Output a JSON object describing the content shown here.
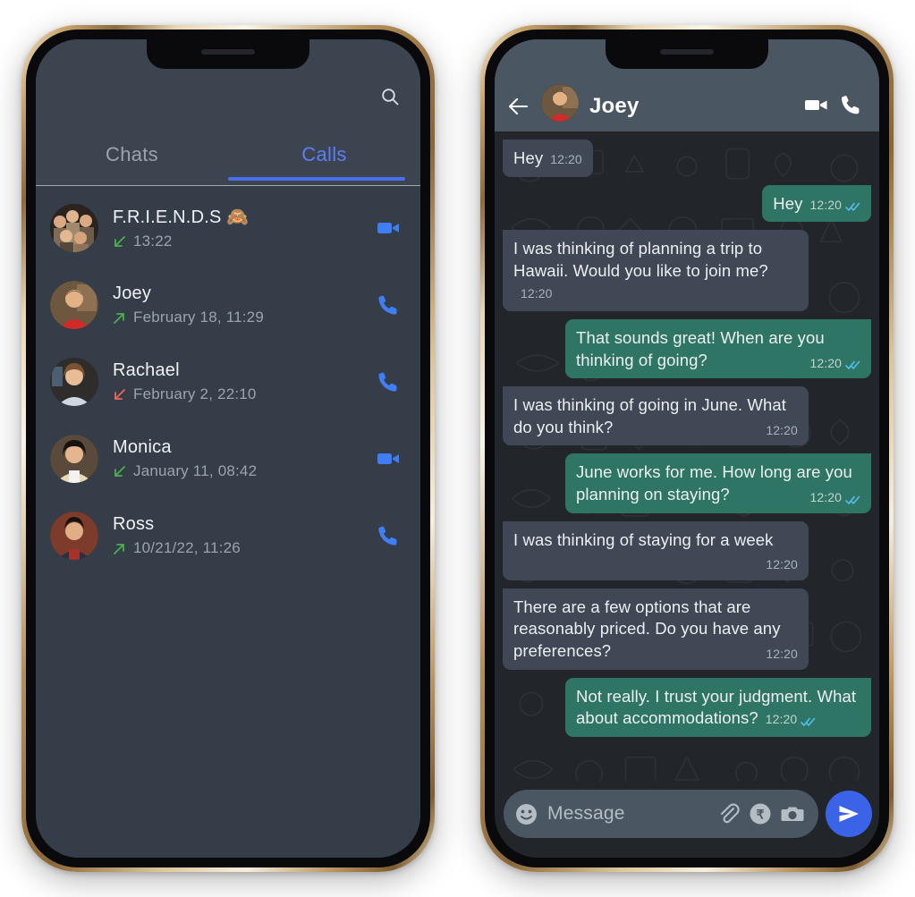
{
  "left_phone": {
    "topbar": {
      "search_icon": "search-icon"
    },
    "tabs": [
      {
        "label": "Chats",
        "active": false
      },
      {
        "label": "Calls",
        "active": true
      }
    ],
    "accent_color": "#4a6ef0",
    "calls": [
      {
        "name": "F.R.I.E.N.D.S 🙈",
        "time": "13:22",
        "direction": "incoming",
        "direction_color": "#4caf50",
        "action_icon": "video-call-icon",
        "action_color": "#3f7ef5"
      },
      {
        "name": "Joey",
        "time": "February 18, 11:29",
        "direction": "outgoing",
        "direction_color": "#4caf50",
        "action_icon": "voice-call-icon",
        "action_color": "#3f7ef5"
      },
      {
        "name": "Rachael",
        "time": "February 2, 22:10",
        "direction": "missed",
        "direction_color": "#e8685d",
        "action_icon": "voice-call-icon",
        "action_color": "#3f7ef5"
      },
      {
        "name": "Monica",
        "time": "January 11, 08:42",
        "direction": "incoming",
        "direction_color": "#4caf50",
        "action_icon": "video-call-icon",
        "action_color": "#3f7ef5"
      },
      {
        "name": "Ross",
        "time": "10/21/22, 11:26",
        "direction": "outgoing",
        "direction_color": "#4caf50",
        "action_icon": "voice-call-icon",
        "action_color": "#3f7ef5"
      }
    ]
  },
  "right_phone": {
    "header": {
      "back_icon": "back-arrow-icon",
      "title": "Joey",
      "video_icon": "video-call-icon",
      "call_icon": "voice-call-icon",
      "bar_color": "#4b5663"
    },
    "messages": [
      {
        "text": "Hey",
        "time": "12:20",
        "side": "in",
        "ticks": false,
        "inline_meta": true
      },
      {
        "text": "Hey",
        "time": "12:20",
        "side": "out",
        "ticks": true,
        "inline_meta": true
      },
      {
        "text": "I was thinking of planning a trip to Hawaii. Would you like to join me?",
        "time": "12:20",
        "side": "in",
        "ticks": false,
        "inline_meta": true
      },
      {
        "text": "That sounds great! When are you thinking of going?",
        "time": "12:20",
        "side": "out",
        "ticks": true,
        "inline_meta": false
      },
      {
        "text": "I was thinking of going in June. What do you think?",
        "time": "12:20",
        "side": "in",
        "ticks": false,
        "inline_meta": false
      },
      {
        "text": "June works for me. How long are you planning on staying?",
        "time": "12:20",
        "side": "out",
        "ticks": true,
        "inline_meta": false
      },
      {
        "text": "I was thinking of staying for a week",
        "time": "12:20",
        "side": "in",
        "ticks": false,
        "inline_meta": false
      },
      {
        "text": "There are a few options that are reasonably priced. Do you have any preferences?",
        "time": "12:20",
        "side": "in",
        "ticks": false,
        "inline_meta": false
      },
      {
        "text": "Not really. I trust your judgment. What about accommodations?",
        "time": "12:20",
        "side": "out",
        "ticks": true,
        "inline_meta": true
      }
    ],
    "footer": {
      "emoji_icon": "emoji-icon",
      "placeholder": "Message",
      "attach_icon": "paperclip-icon",
      "payment_icon": "rupee-payment-icon",
      "camera_icon": "camera-icon",
      "send_icon": "send-icon",
      "send_color": "#3b63e8"
    }
  }
}
